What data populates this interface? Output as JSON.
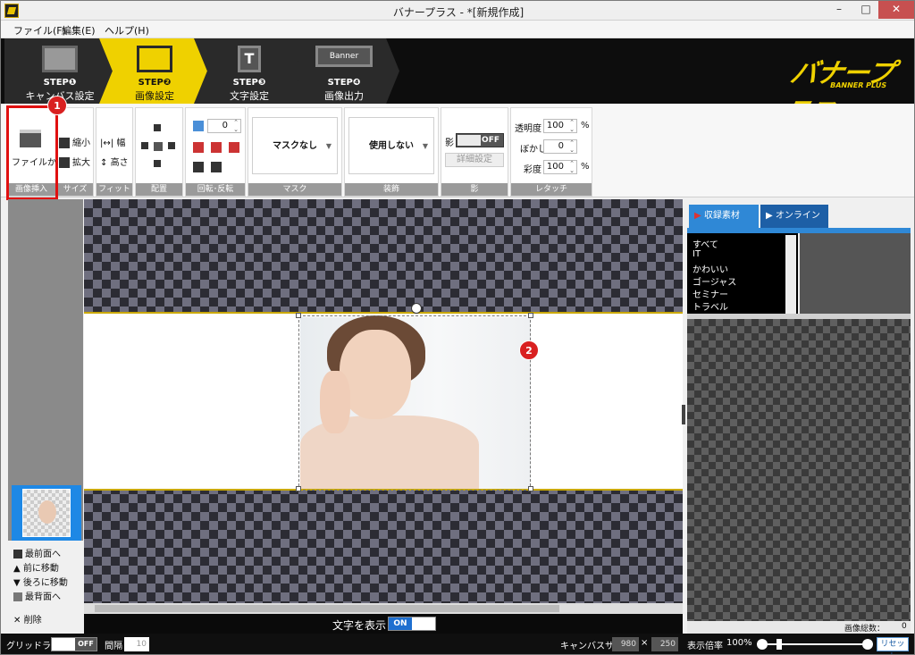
{
  "window": {
    "title": "バナープラス - *[新規作成]",
    "minimize": "–",
    "maximize": "□",
    "close": "✕"
  },
  "menu": [
    "ファイル(F)",
    "編集(E)",
    "ヘルプ(H)"
  ],
  "steps": [
    {
      "num": "STEP❶",
      "label": "キャンバス設定"
    },
    {
      "num": "STEP❷",
      "label": "画像設定"
    },
    {
      "num": "STEP❸",
      "label": "文字設定"
    },
    {
      "num": "STEP❹",
      "label": "画像出力"
    }
  ],
  "step_icons": {
    "s3": "T",
    "s4": "Banner"
  },
  "logo": {
    "main": "バナープラス",
    "sub": "BANNER PLUS"
  },
  "ribbon": {
    "insert": {
      "button": "ファイルから",
      "label": "画像挿入"
    },
    "size": {
      "shrink": "縮小",
      "enlarge": "拡大",
      "label": "サイズ"
    },
    "fit": {
      "width": "幅",
      "height": "高さ",
      "label": "フィット"
    },
    "align": {
      "label": "配置"
    },
    "rotate": {
      "value": "0",
      "label": "回転･反転"
    },
    "mask": {
      "value": "マスクなし",
      "label": "マスク"
    },
    "decor": {
      "value": "使用しない",
      "label": "装飾"
    },
    "shadow": {
      "title": "影",
      "toggle": "OFF",
      "detail": "詳細設定",
      "label": "影"
    },
    "retouch": {
      "opacity_label": "透明度",
      "opacity": "100",
      "blur_label": "ぼかし",
      "blur": "0",
      "saturation_label": "彩度",
      "saturation": "100",
      "unit": "%",
      "label": "レタッチ"
    }
  },
  "annotations": {
    "badge1": "1",
    "badge2": "2"
  },
  "layer_ops": [
    {
      "icon": "bring-front-icon",
      "label": "最前面へ"
    },
    {
      "icon": "forward-icon",
      "label": "前に移動",
      "glyph": "▲"
    },
    {
      "icon": "backward-icon",
      "label": "後ろに移動",
      "glyph": "▼"
    },
    {
      "icon": "send-back-icon",
      "label": "最背面へ"
    },
    {
      "icon": "delete-icon",
      "label": "削除",
      "glyph": "✕"
    }
  ],
  "text_display": {
    "label": "文字を表示",
    "toggle": "ON"
  },
  "right_panel": {
    "tabs": [
      {
        "label": "収録素材",
        "glyph": "▶"
      },
      {
        "label": "オンライン",
        "glyph": "▶"
      }
    ],
    "categories": [
      "すべて",
      "IT",
      "かわいい",
      "ゴージャス",
      "セミナー",
      "トラベル"
    ],
    "total_label": "画像総数：",
    "total": "0"
  },
  "status": {
    "grid_label": "グリッドライン",
    "grid_toggle": "OFF",
    "interval_label": "間隔",
    "interval": "10",
    "canvas_size_label": "キャンバスサイズ",
    "canvas_w": "980",
    "times": "×",
    "canvas_h": "250",
    "zoom_label": "表示倍率",
    "zoom": "100%",
    "reset": "リセット"
  },
  "colors": {
    "accent_yellow": "#efd100",
    "tab_blue": "#2f88d6",
    "highlight_red": "#e01010"
  }
}
